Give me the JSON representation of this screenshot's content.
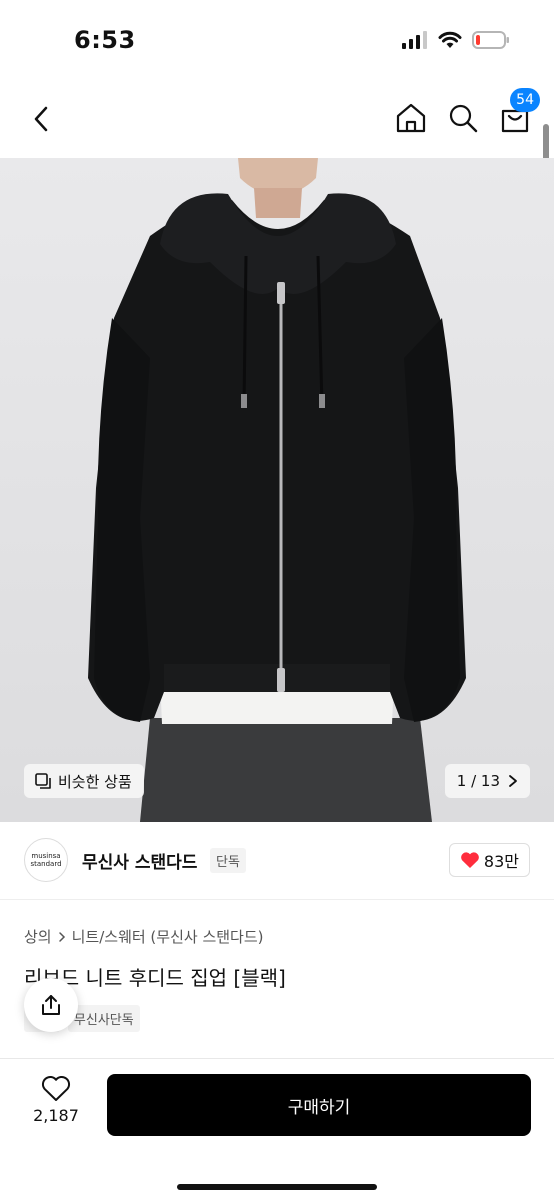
{
  "status_bar": {
    "time": "6:53"
  },
  "nav": {
    "back_icon": "chevron-left-icon",
    "home_icon": "home-icon",
    "search_icon": "search-icon",
    "cart_icon": "cart-icon",
    "cart_badge": "54",
    "badge_color": "#0a84ff"
  },
  "image": {
    "similar_label": "비슷한 상품",
    "page_counter": "1 / 13"
  },
  "brand": {
    "logo_line1": "musinsa",
    "logo_line2": "standard",
    "name": "무신사 스탠다드",
    "tag": "단독",
    "like_count": "83만"
  },
  "product": {
    "category_1": "상의",
    "category_2": "니트/스웨터 (무신사 스탠다드)",
    "title": "리브드 니트 후디드 집업 [블랙]",
    "tags": [
      "배송",
      "무신사단독"
    ]
  },
  "bottom": {
    "wish_count": "2,187",
    "buy_label": "구매하기"
  }
}
